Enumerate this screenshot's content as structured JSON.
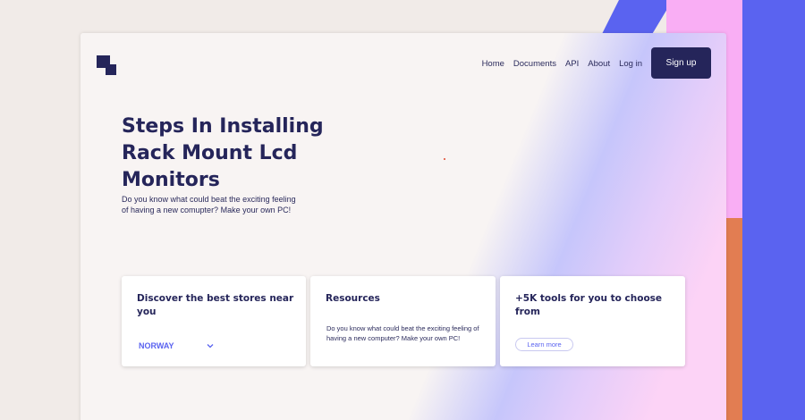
{
  "nav": {
    "items": [
      "Home",
      "Documents",
      "API",
      "About",
      "Log in"
    ],
    "signup_label": "Sign up"
  },
  "hero": {
    "title": "Steps In Installing Rack Mount Lcd Monitors",
    "subtitle": "Do you know what could beat the exciting feeling of having a new comupter? Make your own PC!"
  },
  "cards": [
    {
      "title": "Discover the best stores near you",
      "select_value": "NORWAY",
      "select_icon": "chevron-down-icon"
    },
    {
      "title": "Resources",
      "description": "Do you know what could beat the exciting feeling of having a new computer? Make your own PC!"
    },
    {
      "title": "+5K tools for you to choose from",
      "button_label": "Learn more"
    }
  ],
  "colors": {
    "navy": "#25255a",
    "accent_blue": "#5a63f0",
    "pink": "#f9aef4",
    "orange": "#e27d52"
  }
}
